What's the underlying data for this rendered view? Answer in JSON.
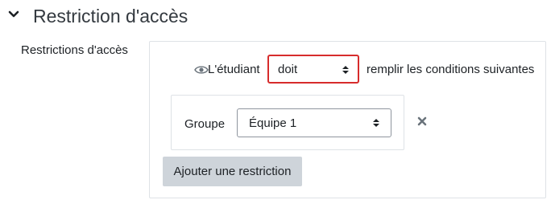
{
  "section": {
    "title": "Restriction d'accès",
    "toggle_icon": "chevron-down-icon"
  },
  "field": {
    "label": "Restrictions d'accès"
  },
  "root_condition": {
    "visibility_icon": "eye-icon",
    "prefix": "L'étudiant",
    "must_select": {
      "selected": "doit",
      "highlight_color": "#d72c2c"
    },
    "suffix": "remplir les conditions suivantes"
  },
  "condition": {
    "label": "Groupe",
    "group_select": {
      "selected": "Équipe 1"
    },
    "delete_icon": "close-icon"
  },
  "add_restriction_label": "Ajouter une restriction"
}
